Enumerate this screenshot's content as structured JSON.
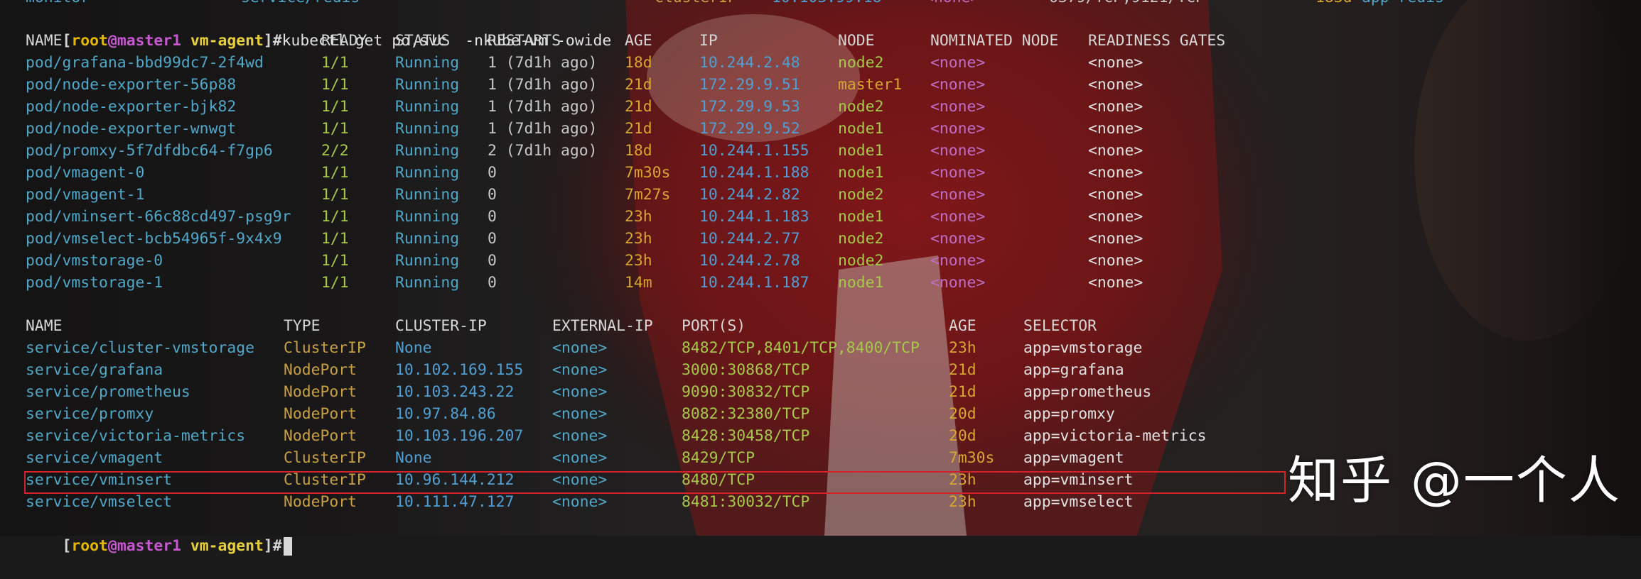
{
  "top_partial": {
    "col1": "monitor",
    "col2": "service/redis",
    "col3": "ClusterIP",
    "col4": "10.103.99.18",
    "col5": "<none>",
    "col6": "6379/TCP,9121/TCP",
    "col7": "183d",
    "col8": "app=redis"
  },
  "prompt": {
    "open": "[",
    "user": "root",
    "at": "@",
    "host": "master1",
    "dir": "vm-agent",
    "close": "]#"
  },
  "command": "kubectl get po,svc  -nkube-vm -owide",
  "pods": {
    "headers": [
      "NAME",
      "READY",
      "STATUS",
      "RESTARTS",
      "AGE",
      "IP",
      "NODE",
      "NOMINATED NODE",
      "READINESS GATES"
    ],
    "rows": [
      [
        "pod/grafana-bbd99dc7-2f4wd",
        "1/1",
        "Running",
        "1 (7d1h ago)",
        "18d",
        "10.244.2.48",
        "node2",
        "<none>",
        "<none>"
      ],
      [
        "pod/node-exporter-56p88",
        "1/1",
        "Running",
        "1 (7d1h ago)",
        "21d",
        "172.29.9.51",
        "master1",
        "<none>",
        "<none>"
      ],
      [
        "pod/node-exporter-bjk82",
        "1/1",
        "Running",
        "1 (7d1h ago)",
        "21d",
        "172.29.9.53",
        "node2",
        "<none>",
        "<none>"
      ],
      [
        "pod/node-exporter-wnwgt",
        "1/1",
        "Running",
        "1 (7d1h ago)",
        "21d",
        "172.29.9.52",
        "node1",
        "<none>",
        "<none>"
      ],
      [
        "pod/promxy-5f7dfdbc64-f7gp6",
        "2/2",
        "Running",
        "2 (7d1h ago)",
        "18d",
        "10.244.1.155",
        "node1",
        "<none>",
        "<none>"
      ],
      [
        "pod/vmagent-0",
        "1/1",
        "Running",
        "0",
        "7m30s",
        "10.244.1.188",
        "node1",
        "<none>",
        "<none>"
      ],
      [
        "pod/vmagent-1",
        "1/1",
        "Running",
        "0",
        "7m27s",
        "10.244.2.82",
        "node2",
        "<none>",
        "<none>"
      ],
      [
        "pod/vminsert-66c88cd497-psg9r",
        "1/1",
        "Running",
        "0",
        "23h",
        "10.244.1.183",
        "node1",
        "<none>",
        "<none>"
      ],
      [
        "pod/vmselect-bcb54965f-9x4x9",
        "1/1",
        "Running",
        "0",
        "23h",
        "10.244.2.77",
        "node2",
        "<none>",
        "<none>"
      ],
      [
        "pod/vmstorage-0",
        "1/1",
        "Running",
        "0",
        "23h",
        "10.244.2.78",
        "node2",
        "<none>",
        "<none>"
      ],
      [
        "pod/vmstorage-1",
        "1/1",
        "Running",
        "0",
        "14m",
        "10.244.1.187",
        "node1",
        "<none>",
        "<none>"
      ]
    ]
  },
  "services": {
    "headers": [
      "NAME",
      "TYPE",
      "CLUSTER-IP",
      "EXTERNAL-IP",
      "PORT(S)",
      "AGE",
      "SELECTOR"
    ],
    "rows": [
      [
        "service/cluster-vmstorage",
        "ClusterIP",
        "None",
        "<none>",
        "8482/TCP,8401/TCP,8400/TCP",
        "23h",
        "app=vmstorage"
      ],
      [
        "service/grafana",
        "NodePort",
        "10.102.169.155",
        "<none>",
        "3000:30868/TCP",
        "21d",
        "app=grafana"
      ],
      [
        "service/prometheus",
        "NodePort",
        "10.103.243.22",
        "<none>",
        "9090:30832/TCP",
        "21d",
        "app=prometheus"
      ],
      [
        "service/promxy",
        "NodePort",
        "10.97.84.86",
        "<none>",
        "8082:32380/TCP",
        "20d",
        "app=promxy"
      ],
      [
        "service/victoria-metrics",
        "NodePort",
        "10.103.196.207",
        "<none>",
        "8428:30458/TCP",
        "20d",
        "app=victoria-metrics"
      ],
      [
        "service/vmagent",
        "ClusterIP",
        "None",
        "<none>",
        "8429/TCP",
        "7m30s",
        "app=vmagent"
      ],
      [
        "service/vminsert",
        "ClusterIP",
        "10.96.144.212",
        "<none>",
        "8480/TCP",
        "23h",
        "app=vminsert"
      ],
      [
        "service/vmselect",
        "NodePort",
        "10.111.47.127",
        "<none>",
        "8481:30032/TCP",
        "23h",
        "app=vmselect"
      ]
    ]
  },
  "highlighted_service": "service/vminsert",
  "watermark": "知乎 @一个人",
  "colors": {
    "background": "#1b1a1a",
    "name_cyan": "#4fa8c9",
    "ready_green": "#a6c94a",
    "age_yellow": "#d8a62e",
    "none_violet": "#c06dc4",
    "highlight_red": "#d0242c"
  }
}
